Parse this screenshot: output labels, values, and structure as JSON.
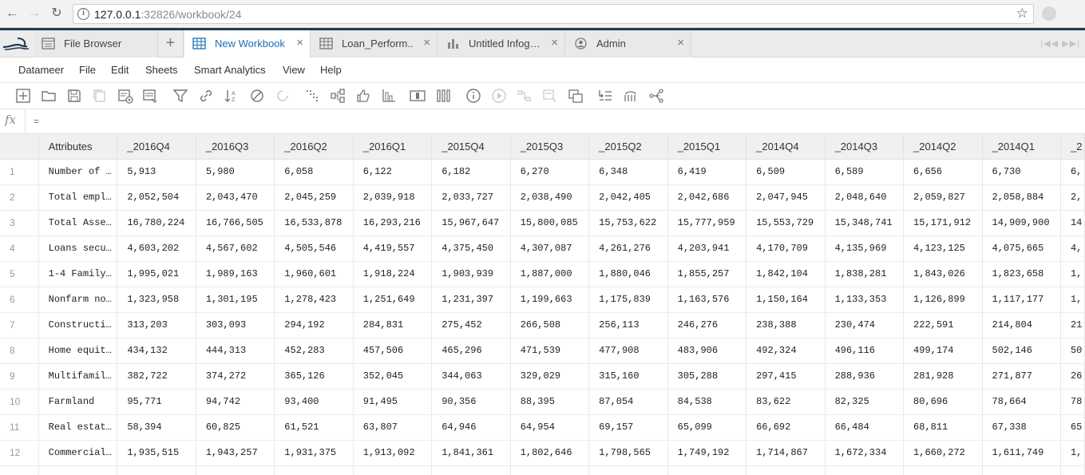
{
  "browser": {
    "url_host": "127.0.0.1",
    "url_rest": ":32826/workbook/24",
    "info_glyph": "i"
  },
  "tabs": {
    "add_label": "+",
    "items": [
      {
        "label": "File Browser",
        "icon": "file-browser-icon",
        "closable": false
      },
      {
        "label": "New Workbook",
        "icon": "workbook-icon",
        "closable": true,
        "active": true
      },
      {
        "label": "Loan_Perform..",
        "icon": "workbook-icon",
        "closable": true
      },
      {
        "label": "Untitled Infog…",
        "icon": "infographic-icon",
        "closable": true
      },
      {
        "label": "Admin",
        "icon": "admin-user-icon",
        "closable": true
      }
    ],
    "close_glyph": "×",
    "nav_glyphs": "|◀◀ ▶▶|"
  },
  "menu": [
    "Datameer",
    "File",
    "Edit",
    "Sheets",
    "Smart Analytics",
    "View",
    "Help"
  ],
  "toolbar": {
    "icons": [
      "add-sheet-icon",
      "open-folder-icon",
      "save-icon",
      "copy-icon",
      "add-data-icon",
      "sheet-list-icon",
      "filter-icon",
      "link-icon",
      "sort-icon",
      "exclude-icon",
      "refresh-icon",
      "dots-icon",
      "join-icon",
      "like-icon",
      "chart-icon",
      "column-icon",
      "bars-icon",
      "info-icon",
      "play-icon",
      "flow-icon",
      "transform-icon",
      "duplicate-icon",
      "indent-icon",
      "tree-icon",
      "branch-icon"
    ]
  },
  "formula": {
    "fx_label": "fx",
    "value": "="
  },
  "grid": {
    "columns": [
      "Attributes",
      "_2016Q4",
      "_2016Q3",
      "_2016Q2",
      "_2016Q1",
      "_2015Q4",
      "_2015Q3",
      "_2015Q2",
      "_2015Q1",
      "_2014Q4",
      "_2014Q3",
      "_2014Q2",
      "_2014Q1",
      "_2"
    ],
    "rows": [
      {
        "n": "1",
        "cells": [
          "Number of …",
          "5,913",
          "5,980",
          "6,058",
          "6,122",
          "6,182",
          "6,270",
          "6,348",
          "6,419",
          "6,509",
          "6,589",
          "6,656",
          "6,730",
          "6,"
        ]
      },
      {
        "n": "2",
        "cells": [
          "Total empl…",
          "2,052,504",
          "2,043,470",
          "2,045,259",
          "2,039,918",
          "2,033,727",
          "2,038,490",
          "2,042,405",
          "2,042,686",
          "2,047,945",
          "2,048,640",
          "2,059,827",
          "2,058,884",
          "2,"
        ]
      },
      {
        "n": "3",
        "cells": [
          "Total Asse…",
          "16,780,224",
          "16,766,505",
          "16,533,878",
          "16,293,216",
          "15,967,647",
          "15,800,085",
          "15,753,622",
          "15,777,959",
          "15,553,729",
          "15,348,741",
          "15,171,912",
          "14,909,900",
          "14"
        ]
      },
      {
        "n": "4",
        "cells": [
          "Loans secu…",
          "4,603,202",
          "4,567,602",
          "4,505,546",
          "4,419,557",
          "4,375,450",
          "4,307,087",
          "4,261,276",
          "4,203,941",
          "4,170,709",
          "4,135,969",
          "4,123,125",
          "4,075,665",
          "4,"
        ]
      },
      {
        "n": "5",
        "cells": [
          "1-4 Family…",
          "1,995,021",
          "1,989,163",
          "1,960,601",
          "1,918,224",
          "1,903,939",
          "1,887,000",
          "1,880,046",
          "1,855,257",
          "1,842,104",
          "1,838,281",
          "1,843,026",
          "1,823,658",
          "1,"
        ]
      },
      {
        "n": "6",
        "cells": [
          "Nonfarm no…",
          "1,323,958",
          "1,301,195",
          "1,278,423",
          "1,251,649",
          "1,231,397",
          "1,199,663",
          "1,175,839",
          "1,163,576",
          "1,150,164",
          "1,133,353",
          "1,126,899",
          "1,117,177",
          "1,"
        ]
      },
      {
        "n": "7",
        "cells": [
          "Constructi…",
          "313,203",
          "303,093",
          "294,192",
          "284,831",
          "275,452",
          "266,508",
          "256,113",
          "246,276",
          "238,388",
          "230,474",
          "222,591",
          "214,804",
          "21"
        ]
      },
      {
        "n": "8",
        "cells": [
          "Home equit…",
          "434,132",
          "444,313",
          "452,283",
          "457,506",
          "465,296",
          "471,539",
          "477,908",
          "483,906",
          "492,324",
          "496,116",
          "499,174",
          "502,146",
          "50"
        ]
      },
      {
        "n": "9",
        "cells": [
          "Multifamil…",
          "382,722",
          "374,272",
          "365,126",
          "352,045",
          "344,063",
          "329,029",
          "315,160",
          "305,288",
          "297,415",
          "288,936",
          "281,928",
          "271,877",
          "26"
        ]
      },
      {
        "n": "10",
        "cells": [
          "Farmland",
          "95,771",
          "94,742",
          "93,400",
          "91,495",
          "90,356",
          "88,395",
          "87,054",
          "84,538",
          "83,622",
          "82,325",
          "80,696",
          "78,664",
          "78"
        ]
      },
      {
        "n": "11",
        "cells": [
          "Real estat…",
          "58,394",
          "60,825",
          "61,521",
          "63,807",
          "64,946",
          "64,954",
          "69,157",
          "65,099",
          "66,692",
          "66,484",
          "68,811",
          "67,338",
          "65"
        ]
      },
      {
        "n": "12",
        "cells": [
          "Commercial…",
          "1,935,515",
          "1,943,257",
          "1,931,375",
          "1,913,092",
          "1,841,361",
          "1,802,646",
          "1,798,565",
          "1,749,192",
          "1,714,867",
          "1,672,334",
          "1,660,272",
          "1,611,749",
          "1,"
        ]
      },
      {
        "n": "",
        "cells": [
          "",
          "",
          "",
          "",
          "",
          "",
          "",
          "",
          "",
          "",
          "",
          "",
          "",
          ""
        ]
      }
    ]
  }
}
